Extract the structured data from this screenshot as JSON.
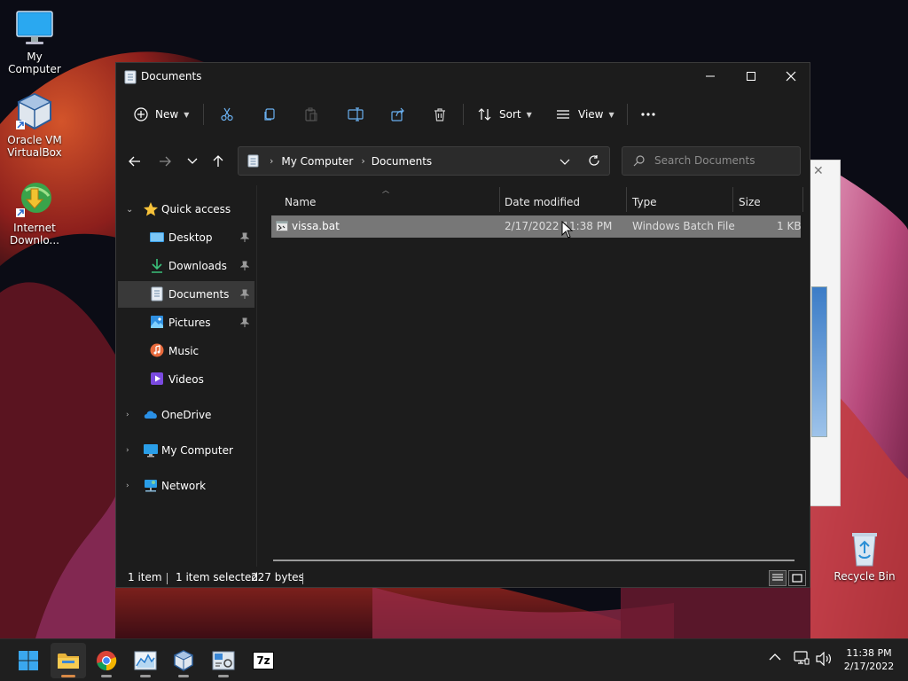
{
  "desktop": {
    "icons": [
      {
        "label": "My Computer"
      },
      {
        "label": "Oracle VM VirtualBox"
      },
      {
        "label": "Internet Downlo..."
      },
      {
        "label": "Recycle Bin"
      }
    ]
  },
  "window": {
    "title": "Documents",
    "toolbar": {
      "new_label": "New",
      "sort_label": "Sort",
      "view_label": "View"
    },
    "address": {
      "crumbs": [
        "My Computer",
        "Documents"
      ]
    },
    "search": {
      "placeholder": "Search Documents"
    },
    "sidebar": {
      "items": [
        {
          "label": "Quick access",
          "icon": "star-icon"
        },
        {
          "label": "Desktop",
          "icon": "desktop-icon",
          "pinned": true
        },
        {
          "label": "Downloads",
          "icon": "download-icon",
          "pinned": true
        },
        {
          "label": "Documents",
          "icon": "documents-icon",
          "pinned": true,
          "selected": true
        },
        {
          "label": "Pictures",
          "icon": "pictures-icon",
          "pinned": true
        },
        {
          "label": "Music",
          "icon": "music-icon"
        },
        {
          "label": "Videos",
          "icon": "videos-icon"
        },
        {
          "label": "OneDrive",
          "icon": "cloud-icon"
        },
        {
          "label": "My Computer",
          "icon": "monitor-icon"
        },
        {
          "label": "Network",
          "icon": "network-icon"
        }
      ]
    },
    "columns": [
      "Name",
      "Date modified",
      "Type",
      "Size"
    ],
    "files": [
      {
        "name": "vissa.bat",
        "date": "2/17/2022 11:38 PM",
        "type": "Windows Batch File",
        "size": "1 KB",
        "selected": true
      }
    ],
    "status": {
      "count": "1 item",
      "selection": "1 item selected",
      "bytes": "227 bytes"
    }
  },
  "taskbar": {
    "time": "11:38 PM",
    "date": "2/17/2022",
    "apps": [
      "windows-start-icon",
      "file-explorer-icon",
      "chrome-icon",
      "task-manager-icon",
      "virtualbox-icon",
      "settings-app-icon",
      "7zip-icon"
    ],
    "sevenzip_label": "7z"
  },
  "colors": {
    "window_bg": "#1c1c1c",
    "selection": "#777777",
    "accent": "#0078d4",
    "taskbar": "#1f1f1f"
  }
}
